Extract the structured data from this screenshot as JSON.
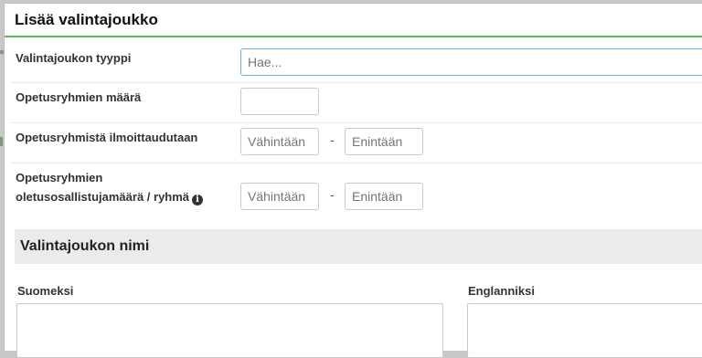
{
  "modal": {
    "title": "Lisää valintajoukko"
  },
  "fields": {
    "type": {
      "label": "Valintajoukon tyyppi",
      "placeholder": "Hae...",
      "value": ""
    },
    "group_count": {
      "label": "Opetusryhmien määrä",
      "value": ""
    },
    "enroll": {
      "label": "Opetusryhmistä ilmoittaudutaan",
      "min_placeholder": "Vähintään",
      "max_placeholder": "Enintään",
      "separator": "-"
    },
    "default_size": {
      "label_line1": "Opetusryhmien",
      "label_line2": "oletusosallistujamäärä / ryhmä",
      "min_placeholder": "Vähintään",
      "max_placeholder": "Enintään",
      "separator": "-",
      "info_glyph": "i"
    }
  },
  "name_section": {
    "title": "Valintajoukon nimi",
    "finnish_label": "Suomeksi",
    "english_label": "Englanniksi"
  },
  "colors": {
    "accent_line": "#5cb85c",
    "focus_border": "#66afe9",
    "section_band": "#ebebeb"
  }
}
